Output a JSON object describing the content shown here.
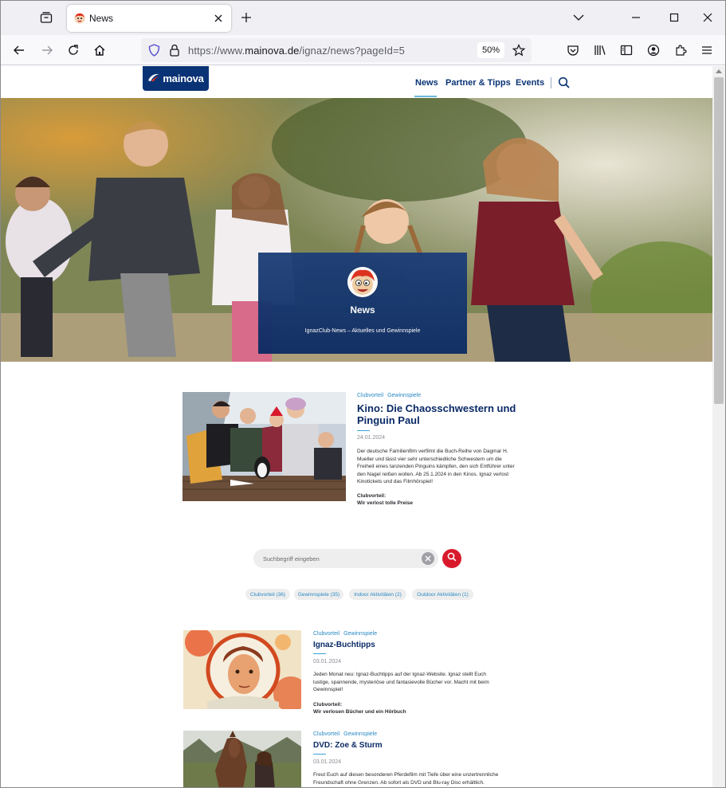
{
  "browser": {
    "tab_title": "News",
    "url_prefix": "https://www.",
    "url_host": "mainova.de",
    "url_path": "/ignaz/news?pageId=5",
    "zoom": "50%"
  },
  "site": {
    "logo_text": "mainova",
    "nav": [
      "News",
      "Partner & Tipps",
      "Events"
    ]
  },
  "hero": {
    "title": "News",
    "subtitle": "IgnazClub-News – Aktuelles und Gewinnspiele"
  },
  "featured": {
    "tags": [
      "Clubvorteil",
      "Gewinnspiele"
    ],
    "title": "Kino: Die Chaosschwestern und Pinguin Paul",
    "date": "24.01.2024",
    "description": "Der deutsche Familienfilm verfilmt die Buch-Reihe von Dagmar H. Mueller und lässt vier sehr unterschiedliche Schwestern um die Freiheit eines tanzenden Pinguins kämpfen, den sich Entführer unter den Nagel reißen wollen. Ab 25.1.2024 in den Kinos. Ignaz verlost Kinotickets und das Filmhörspiel!",
    "club_label": "Clubvorteil:",
    "club_text": "Wir verlost tolle Preise"
  },
  "search": {
    "placeholder": "Suchbegriff eingeben"
  },
  "filters": [
    "Clubvorteil (36)",
    "Gewinnspiele (35)",
    "Indoor Aktivitäten (2)",
    "Outdoor Aktivitäten (1)"
  ],
  "articles": [
    {
      "tags": [
        "Clubvorteil",
        "Gewinnspiele"
      ],
      "title": "Ignaz-Buchtipps",
      "date": "03.01.2024",
      "description": "Jeden Monat neu: Ignaz-Buchtipps auf der Ignaz-Website. Ignaz stellt Euch lustige, spannende, mysteriöse und fantasievolle Bücher vor. Macht mit beim Gewinnspiel!",
      "club_label": "Clubvorteil:",
      "club_text": "Wir verlosen Bücher und ein Hörbuch"
    },
    {
      "tags": [
        "Clubvorteil",
        "Gewinnspiele"
      ],
      "title": "DVD: Zoe & Sturm",
      "date": "03.01.2024",
      "description": "Freut Euch auf diesen besonderen Pferdefilm mit Tiefe über eine unzertrennliche Freundschaft ohne Grenzen. Ab sofort als DVD und Blu-ray Disc erhältlich."
    }
  ],
  "colors": {
    "brand_navy": "#0a3375",
    "link_blue": "#2a89c2",
    "accent_red": "#d8192c"
  }
}
